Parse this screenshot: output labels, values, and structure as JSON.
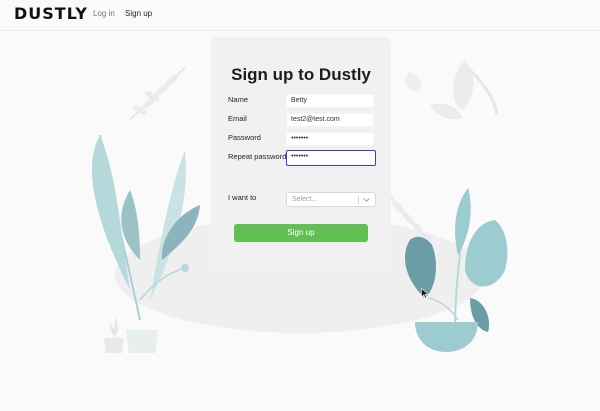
{
  "nav": {
    "logo": "DUSTLY",
    "login": "Log in",
    "signup": "Sign up"
  },
  "form": {
    "title": "Sign up to Dustly",
    "name_label": "Name",
    "name_value": "Betty",
    "email_label": "Email",
    "email_value": "test2@test.com",
    "password_label": "Password",
    "password_value": "•••••••",
    "repeat_label": "Repeat password",
    "repeat_value": "•••••••",
    "intent_label": "I want to",
    "intent_placeholder": "Select...",
    "submit_label": "Sign up"
  },
  "colors": {
    "accent": "#62bf52",
    "focus": "#3b3bd6",
    "plant_teal": "#9ccbd0",
    "plant_dark": "#6c9da6"
  }
}
